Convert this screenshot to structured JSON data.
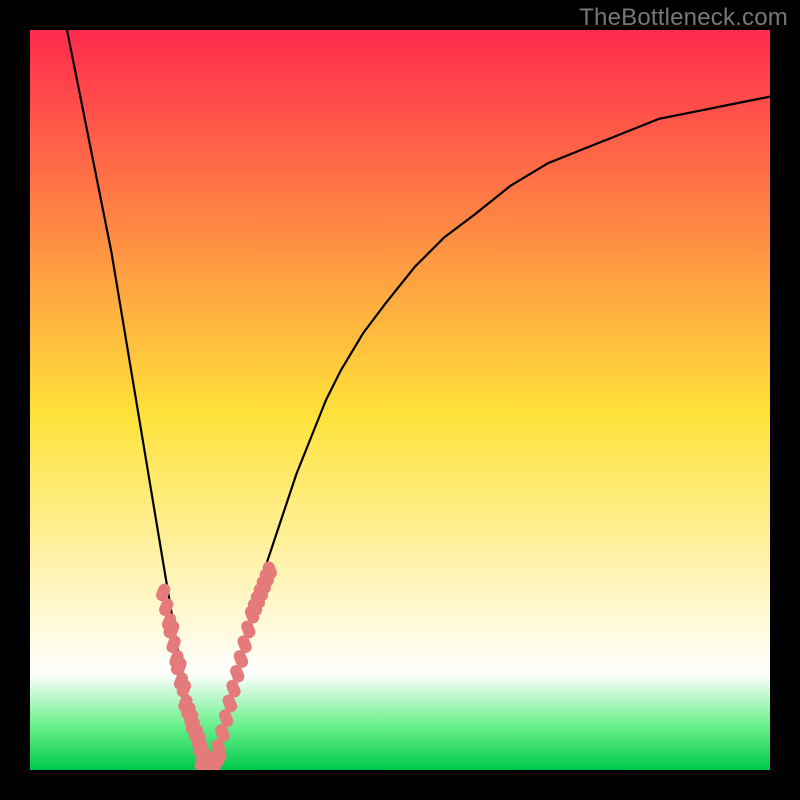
{
  "watermark": "TheBottleneck.com",
  "chart_data": {
    "type": "line",
    "title": "",
    "xlabel": "",
    "ylabel": "",
    "xlim": [
      0,
      100
    ],
    "ylim": [
      0,
      100
    ],
    "grid": false,
    "legend": false,
    "background_gradient_stops": [
      {
        "pos": 0.0,
        "color": "#ff2a4d"
      },
      {
        "pos": 0.52,
        "color": "#ffe23a"
      },
      {
        "pos": 0.87,
        "color": "#ffffff"
      },
      {
        "pos": 0.94,
        "color": "#6af08b"
      },
      {
        "pos": 1.0,
        "color": "#00c94a"
      }
    ],
    "curve_minimum_x": 24,
    "series": [
      {
        "name": "curve",
        "type": "line",
        "x": [
          5,
          6,
          7,
          8,
          9,
          10,
          11,
          12,
          13,
          14,
          15,
          16,
          17,
          18,
          19,
          20,
          21,
          22,
          23,
          24,
          25,
          26,
          27,
          28,
          29,
          30,
          32,
          34,
          36,
          38,
          40,
          42,
          45,
          48,
          52,
          56,
          60,
          65,
          70,
          75,
          80,
          85,
          90,
          95,
          100
        ],
        "y": [
          100,
          95,
          90,
          85,
          80,
          75,
          70,
          64,
          58,
          52,
          46,
          40,
          34,
          28,
          22,
          16,
          11,
          7,
          3,
          0,
          2,
          5,
          9,
          13,
          17,
          21,
          28,
          34,
          40,
          45,
          50,
          54,
          59,
          63,
          68,
          72,
          75,
          79,
          82,
          84,
          86,
          88,
          89,
          90,
          91
        ]
      },
      {
        "name": "points-left",
        "type": "scatter",
        "color": "#e57a7a",
        "x": [
          18.0,
          18.4,
          18.8,
          19.2,
          19.0,
          19.4,
          19.8,
          20.2,
          20.0,
          20.4,
          20.8,
          21.0,
          21.4,
          21.8,
          22.0,
          22.4,
          22.8,
          23.0,
          23.4
        ],
        "y": [
          24,
          22,
          20,
          19,
          19,
          17,
          15,
          14,
          14,
          12,
          11,
          9,
          8,
          7,
          6,
          5,
          4,
          3,
          2
        ]
      },
      {
        "name": "points-bottom",
        "type": "scatter",
        "color": "#e57a7a",
        "x": [
          23.2,
          23.6,
          24.0,
          24.4,
          24.8,
          25.2,
          25.6
        ],
        "y": [
          1,
          0.5,
          0,
          0.3,
          0.8,
          1.5,
          2.2
        ]
      },
      {
        "name": "points-right",
        "type": "scatter",
        "color": "#e57a7a",
        "x": [
          25.5,
          26.0,
          26.5,
          27.0,
          27.0,
          27.5,
          28.0,
          28.5,
          28.5,
          29.0,
          29.5,
          30.0,
          30.4,
          30.8,
          31.2,
          31.6,
          32.0,
          32.4
        ],
        "y": [
          3,
          5,
          7,
          9,
          9,
          11,
          13,
          15,
          15,
          17,
          19,
          21,
          22,
          23,
          24,
          25,
          26,
          27
        ]
      }
    ]
  }
}
